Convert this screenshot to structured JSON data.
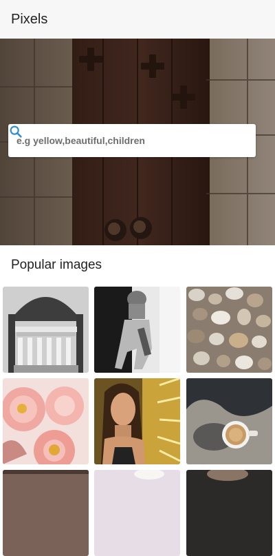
{
  "app_bar": {
    "title": "Pixels"
  },
  "search": {
    "placeholder": "e.g yellow,beautiful,children",
    "icon": "search-icon"
  },
  "section": {
    "title": "Popular images"
  },
  "colors": {
    "accent": "#2f8fd0",
    "app_bar_bg": "#f7f7f7"
  },
  "images": [
    {
      "name": "temple-columns"
    },
    {
      "name": "woman-in-jeans"
    },
    {
      "name": "pebbles"
    },
    {
      "name": "pink-peonies"
    },
    {
      "name": "girl-golden-light"
    },
    {
      "name": "coffee-cup-on-ground"
    },
    {
      "name": "partial-image-1"
    },
    {
      "name": "partial-image-2"
    },
    {
      "name": "partial-image-3"
    }
  ]
}
